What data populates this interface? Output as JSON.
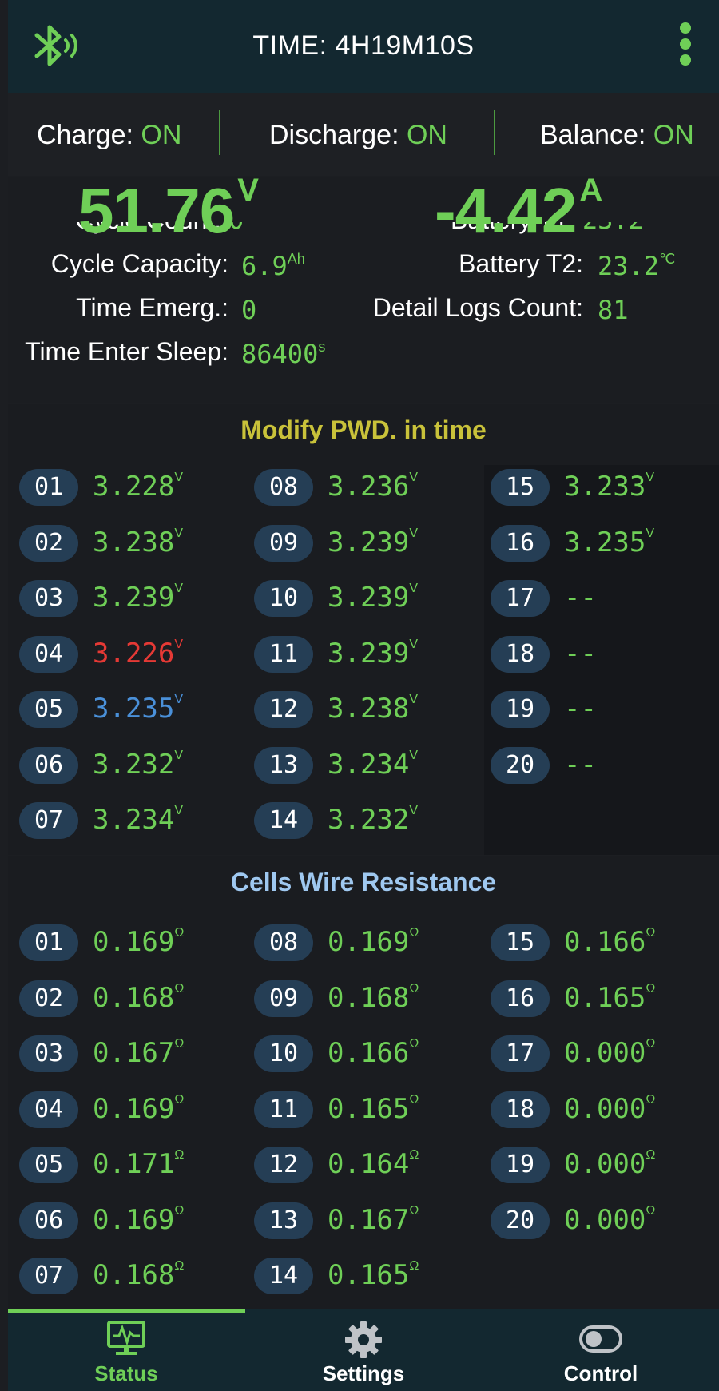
{
  "header": {
    "time_label": "TIME: 4H19M10S",
    "bluetooth_icon": "bluetooth-connected-icon",
    "menu_icon": "more-vert-icon",
    "accent": "#6fcf57"
  },
  "switches": {
    "charge_label": "Charge:",
    "charge_value": "ON",
    "discharge_label": "Discharge:",
    "discharge_value": "ON",
    "balance_label": "Balance:",
    "balance_value": "ON"
  },
  "metrics": {
    "voltage": "51.76",
    "voltage_unit": "V",
    "current": "-4.42",
    "current_unit": "A",
    "cycle_count_label": "Cycle Count:",
    "cycle_count_value": "0",
    "battery_t1_label": "Battery T1:",
    "battery_t1_value": "23.2",
    "cycle_capacity_label": "Cycle Capacity:",
    "cycle_capacity_value": "6.9",
    "cycle_capacity_unit": "Ah",
    "battery_t2_label": "Battery T2:",
    "battery_t2_value": "23.2",
    "battery_t2_unit": "℃",
    "time_emerg_label": "Time Emerg.:",
    "time_emerg_value": "0",
    "detail_logs_label": "Detail Logs Count:",
    "detail_logs_value": "81",
    "sleep_label": "Time Enter Sleep:",
    "sleep_value": "86400",
    "sleep_unit": "s"
  },
  "voltages": {
    "title": "Modify PWD. in time",
    "title_color": "#c9c23a",
    "unit": "V",
    "cells": [
      {
        "id": "01",
        "value": "3.228",
        "unit": "V",
        "color": "#6fcf57"
      },
      {
        "id": "02",
        "value": "3.238",
        "unit": "V",
        "color": "#6fcf57"
      },
      {
        "id": "03",
        "value": "3.239",
        "unit": "V",
        "color": "#6fcf57"
      },
      {
        "id": "04",
        "value": "3.226",
        "unit": "V",
        "color": "#e53935"
      },
      {
        "id": "05",
        "value": "3.235",
        "unit": "V",
        "color": "#4a90d9"
      },
      {
        "id": "06",
        "value": "3.232",
        "unit": "V",
        "color": "#6fcf57"
      },
      {
        "id": "07",
        "value": "3.234",
        "unit": "V",
        "color": "#6fcf57"
      },
      {
        "id": "08",
        "value": "3.236",
        "unit": "V",
        "color": "#6fcf57"
      },
      {
        "id": "09",
        "value": "3.239",
        "unit": "V",
        "color": "#6fcf57"
      },
      {
        "id": "10",
        "value": "3.239",
        "unit": "V",
        "color": "#6fcf57"
      },
      {
        "id": "11",
        "value": "3.239",
        "unit": "V",
        "color": "#6fcf57"
      },
      {
        "id": "12",
        "value": "3.238",
        "unit": "V",
        "color": "#6fcf57"
      },
      {
        "id": "13",
        "value": "3.234",
        "unit": "V",
        "color": "#6fcf57"
      },
      {
        "id": "14",
        "value": "3.232",
        "unit": "V",
        "color": "#6fcf57"
      },
      {
        "id": "15",
        "value": "3.233",
        "unit": "V",
        "color": "#6fcf57"
      },
      {
        "id": "16",
        "value": "3.235",
        "unit": "V",
        "color": "#6fcf57"
      },
      {
        "id": "17",
        "value": "--",
        "unit": "",
        "color": "#6fcf57"
      },
      {
        "id": "18",
        "value": "--",
        "unit": "",
        "color": "#6fcf57"
      },
      {
        "id": "19",
        "value": "--",
        "unit": "",
        "color": "#6fcf57"
      },
      {
        "id": "20",
        "value": "--",
        "unit": "",
        "color": "#6fcf57"
      }
    ]
  },
  "resistances": {
    "title": "Cells Wire Resistance",
    "title_color": "#9fc8f0",
    "cells": [
      {
        "id": "01",
        "value": "0.169",
        "unit": "Ω"
      },
      {
        "id": "02",
        "value": "0.168",
        "unit": "Ω"
      },
      {
        "id": "03",
        "value": "0.167",
        "unit": "Ω"
      },
      {
        "id": "04",
        "value": "0.169",
        "unit": "Ω"
      },
      {
        "id": "05",
        "value": "0.171",
        "unit": "Ω"
      },
      {
        "id": "06",
        "value": "0.169",
        "unit": "Ω"
      },
      {
        "id": "07",
        "value": "0.168",
        "unit": "Ω"
      },
      {
        "id": "08",
        "value": "0.169",
        "unit": "Ω"
      },
      {
        "id": "09",
        "value": "0.168",
        "unit": "Ω"
      },
      {
        "id": "10",
        "value": "0.166",
        "unit": "Ω"
      },
      {
        "id": "11",
        "value": "0.165",
        "unit": "Ω"
      },
      {
        "id": "12",
        "value": "0.164",
        "unit": "Ω"
      },
      {
        "id": "13",
        "value": "0.167",
        "unit": "Ω"
      },
      {
        "id": "14",
        "value": "0.165",
        "unit": "Ω"
      },
      {
        "id": "15",
        "value": "0.166",
        "unit": "Ω"
      },
      {
        "id": "16",
        "value": "0.165",
        "unit": "Ω"
      },
      {
        "id": "17",
        "value": "0.000",
        "unit": "Ω"
      },
      {
        "id": "18",
        "value": "0.000",
        "unit": "Ω"
      },
      {
        "id": "19",
        "value": "0.000",
        "unit": "Ω"
      },
      {
        "id": "20",
        "value": "0.000",
        "unit": "Ω"
      }
    ]
  },
  "nav": {
    "status_label": "Status",
    "status_icon": "monitor-pulse-icon",
    "settings_label": "Settings",
    "settings_icon": "gear-icon",
    "control_label": "Control",
    "control_icon": "toggle-icon",
    "active": "Status"
  }
}
